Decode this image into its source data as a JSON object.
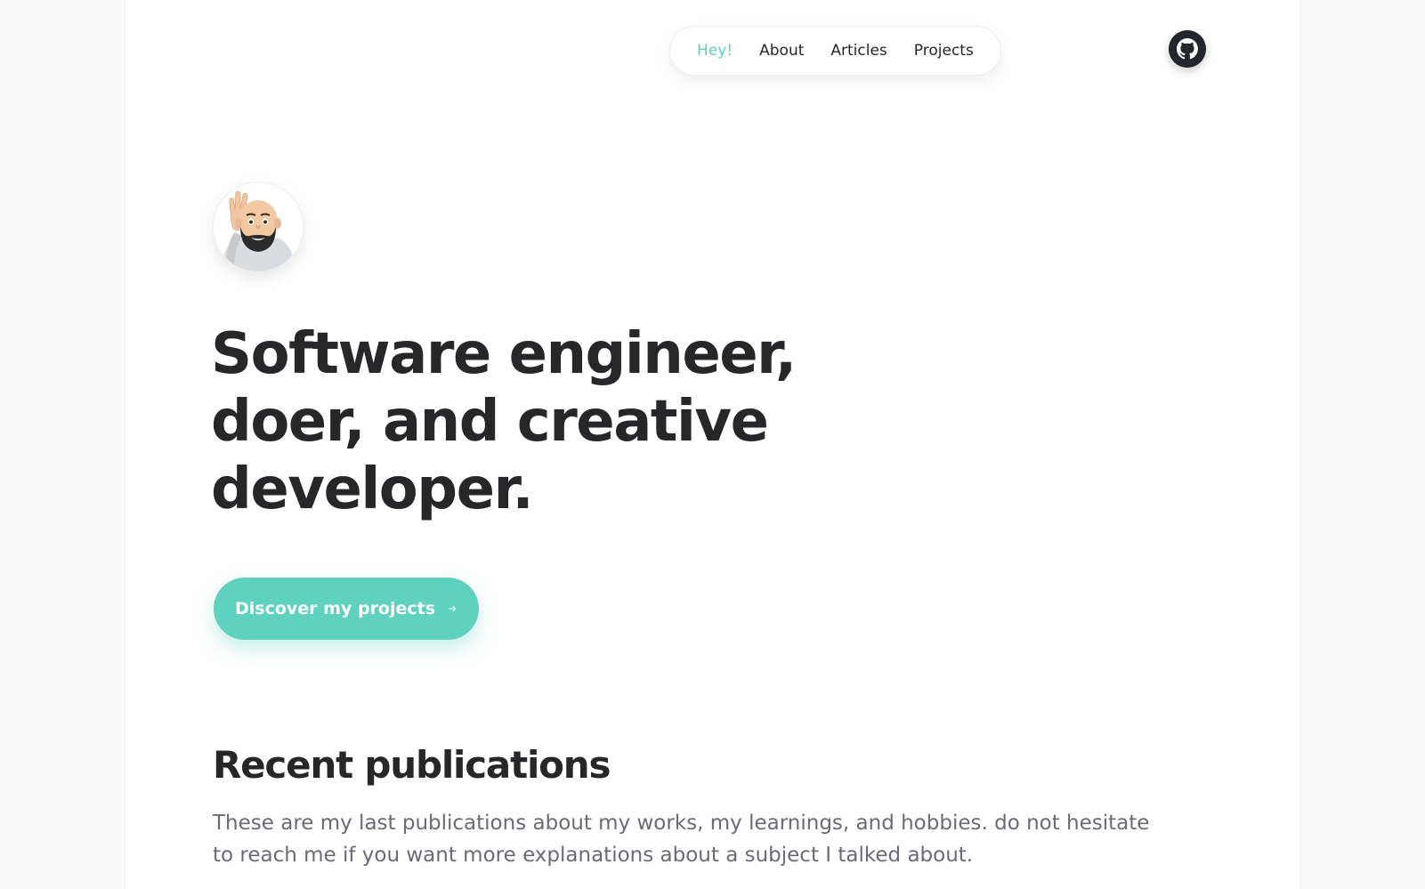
{
  "nav": {
    "items": [
      {
        "label": "Hey!",
        "active": true
      },
      {
        "label": "About",
        "active": false
      },
      {
        "label": "Articles",
        "active": false
      },
      {
        "label": "Projects",
        "active": false
      }
    ]
  },
  "header": {
    "github_icon": "github-icon"
  },
  "hero": {
    "avatar_icon": "memoji-avatar",
    "headline": {
      "line1": "Software engineer,",
      "line2": "doer, and creative",
      "line3": "developer."
    },
    "cta_label": "Discover my projects",
    "cta_icon": "arrow-right-icon"
  },
  "publications": {
    "title": "Recent publications",
    "description": "These are my last publications about my works, my learnings, and hobbies. do not hesitate to reach me if you want more explanations about a subject I talked about."
  },
  "colors": {
    "accent": "#5ed1bf",
    "text": "#27272a",
    "muted": "#6b6b73",
    "background": "#fafafa"
  }
}
